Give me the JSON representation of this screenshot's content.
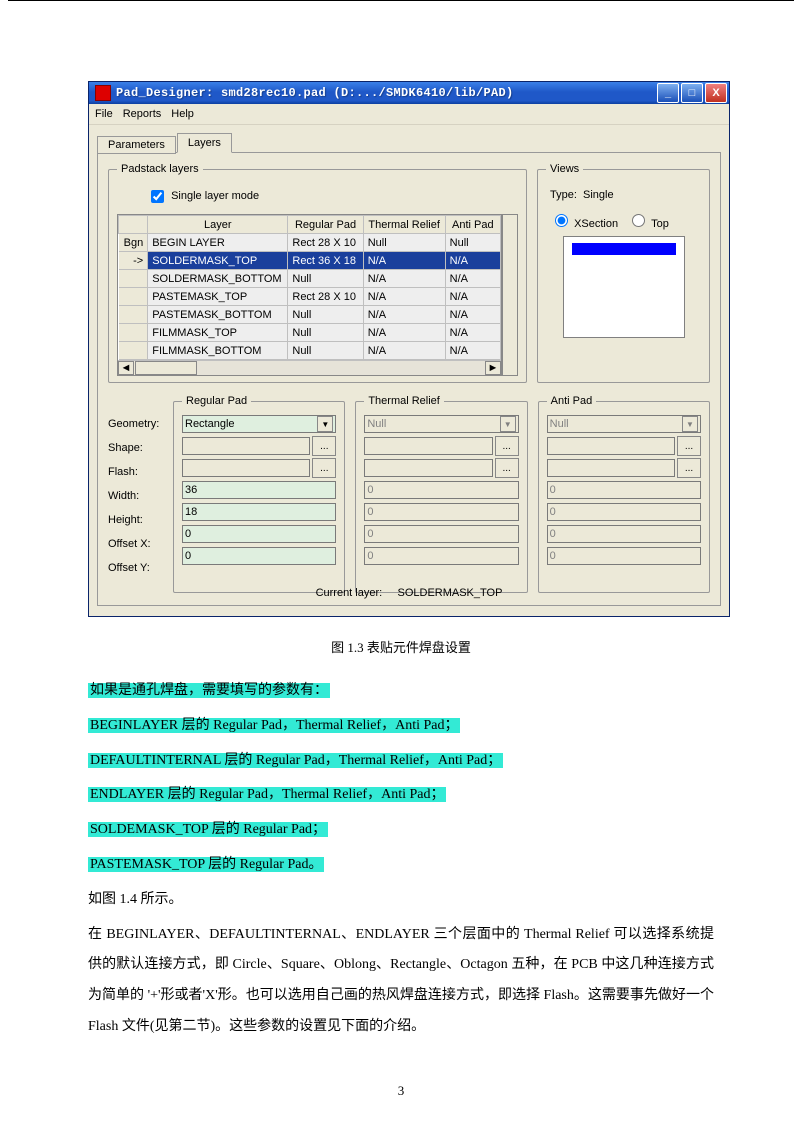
{
  "window": {
    "title": "Pad_Designer: smd28rec10.pad (D:.../SMDK6410/lib/PAD)",
    "menus": {
      "file": "File",
      "reports": "Reports",
      "help": "Help"
    },
    "win_btns": {
      "min": "_",
      "max": "□",
      "close": "X"
    },
    "tabs": {
      "parameters": "Parameters",
      "layers": "Layers"
    },
    "padstack_legend": "Padstack layers",
    "single_layer": "Single layer mode",
    "table": {
      "headers": {
        "blank": "",
        "layer": "Layer",
        "regular": "Regular Pad",
        "thermal": "Thermal Relief",
        "anti": "Anti Pad"
      },
      "rows": [
        {
          "rh": "Bgn",
          "l": "BEGIN LAYER",
          "r": "Rect 28 X 10",
          "t": "Null",
          "a": "Null",
          "sel": false
        },
        {
          "rh": "->",
          "l": "SOLDERMASK_TOP",
          "r": "Rect 36 X 18",
          "t": "N/A",
          "a": "N/A",
          "sel": true
        },
        {
          "rh": "",
          "l": "SOLDERMASK_BOTTOM",
          "r": "Null",
          "t": "N/A",
          "a": "N/A",
          "sel": false
        },
        {
          "rh": "",
          "l": "PASTEMASK_TOP",
          "r": "Rect 28 X 10",
          "t": "N/A",
          "a": "N/A",
          "sel": false
        },
        {
          "rh": "",
          "l": "PASTEMASK_BOTTOM",
          "r": "Null",
          "t": "N/A",
          "a": "N/A",
          "sel": false
        },
        {
          "rh": "",
          "l": "FILMMASK_TOP",
          "r": "Null",
          "t": "N/A",
          "a": "N/A",
          "sel": false
        },
        {
          "rh": "",
          "l": "FILMMASK_BOTTOM",
          "r": "Null",
          "t": "N/A",
          "a": "N/A",
          "sel": false
        }
      ]
    },
    "views": {
      "legend": "Views",
      "type_label": "Type:",
      "type_value": "Single",
      "xsection": "XSection",
      "top": "Top"
    },
    "labels": {
      "geometry": "Geometry:",
      "shape": "Shape:",
      "flash": "Flash:",
      "width": "Width:",
      "height": "Height:",
      "offx": "Offset X:",
      "offy": "Offset Y:"
    },
    "regular": {
      "legend": "Regular Pad",
      "geometry": "Rectangle",
      "shape": "",
      "flash": "",
      "width": "36",
      "height": "18",
      "offx": "0",
      "offy": "0"
    },
    "thermal": {
      "legend": "Thermal Relief",
      "value": "Null",
      "zero": "0"
    },
    "anti": {
      "legend": "Anti Pad",
      "value": "Null",
      "zero": "0"
    },
    "browse": "...",
    "current_layer_label": "Current layer:",
    "current_layer_value": "SOLDERMASK_TOP"
  },
  "doc": {
    "caption": "图 1.3  表贴元件焊盘设置",
    "p1": "如果是通孔焊盘，需要填写的参数有：",
    "p2": "BEGINLAYER 层的 Regular Pad，Thermal Relief，Anti Pad；",
    "p3": "DEFAULTINTERNAL 层的 Regular Pad，Thermal Relief，Anti Pad；",
    "p4": "ENDLAYER 层的 Regular Pad，Thermal Relief，Anti Pad；",
    "p5": "SOLDEMASK_TOP 层的 Regular Pad；",
    "p6": "PASTEMASK_TOP 层的 Regular Pad。",
    "p7": "如图 1.4 所示。",
    "p8": "在 BEGINLAYER、DEFAULTINTERNAL、ENDLAYER 三个层面中的 Thermal Relief 可以选择系统提供的默认连接方式，即 Circle、Square、Oblong、Rectangle、Octagon 五种，在 PCB 中这几种连接方式为简单的 '+'形或者'X'形。也可以选用自己画的热风焊盘连接方式，即选择 Flash。这需要事先做好一个 Flash 文件(见第二节)。这些参数的设置见下面的介绍。",
    "pagenum": "3"
  }
}
